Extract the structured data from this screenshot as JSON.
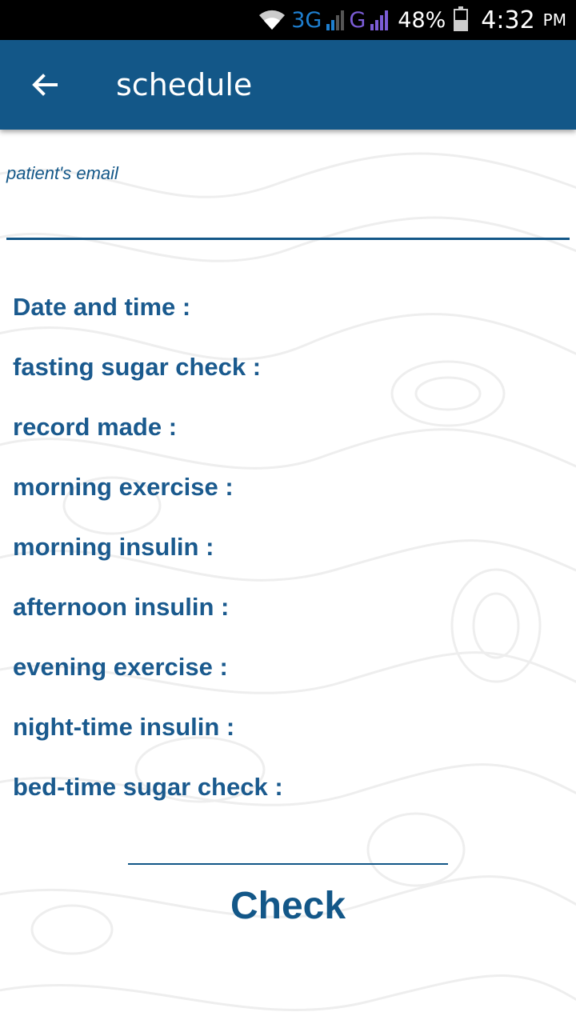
{
  "status_bar": {
    "network_3g": "3G",
    "network_g": "G",
    "battery": "48%",
    "battery_level": 0.48,
    "time": "4:32",
    "ampm": "PM"
  },
  "app_bar": {
    "title": "schedule",
    "back_icon": "arrow-left-icon",
    "color": "#135788"
  },
  "form": {
    "email_label": "patient's email",
    "email_value": ""
  },
  "fields": [
    "Date and time :",
    "fasting sugar check :",
    "record made :",
    "morning exercise :",
    "morning insulin :",
    "afternoon insulin :",
    "evening exercise :",
    "night-time insulin :",
    "bed-time sugar check :"
  ],
  "check_button": {
    "label": "Check"
  },
  "colors": {
    "accent": "#135788",
    "field_text": "#1a5a8e"
  }
}
